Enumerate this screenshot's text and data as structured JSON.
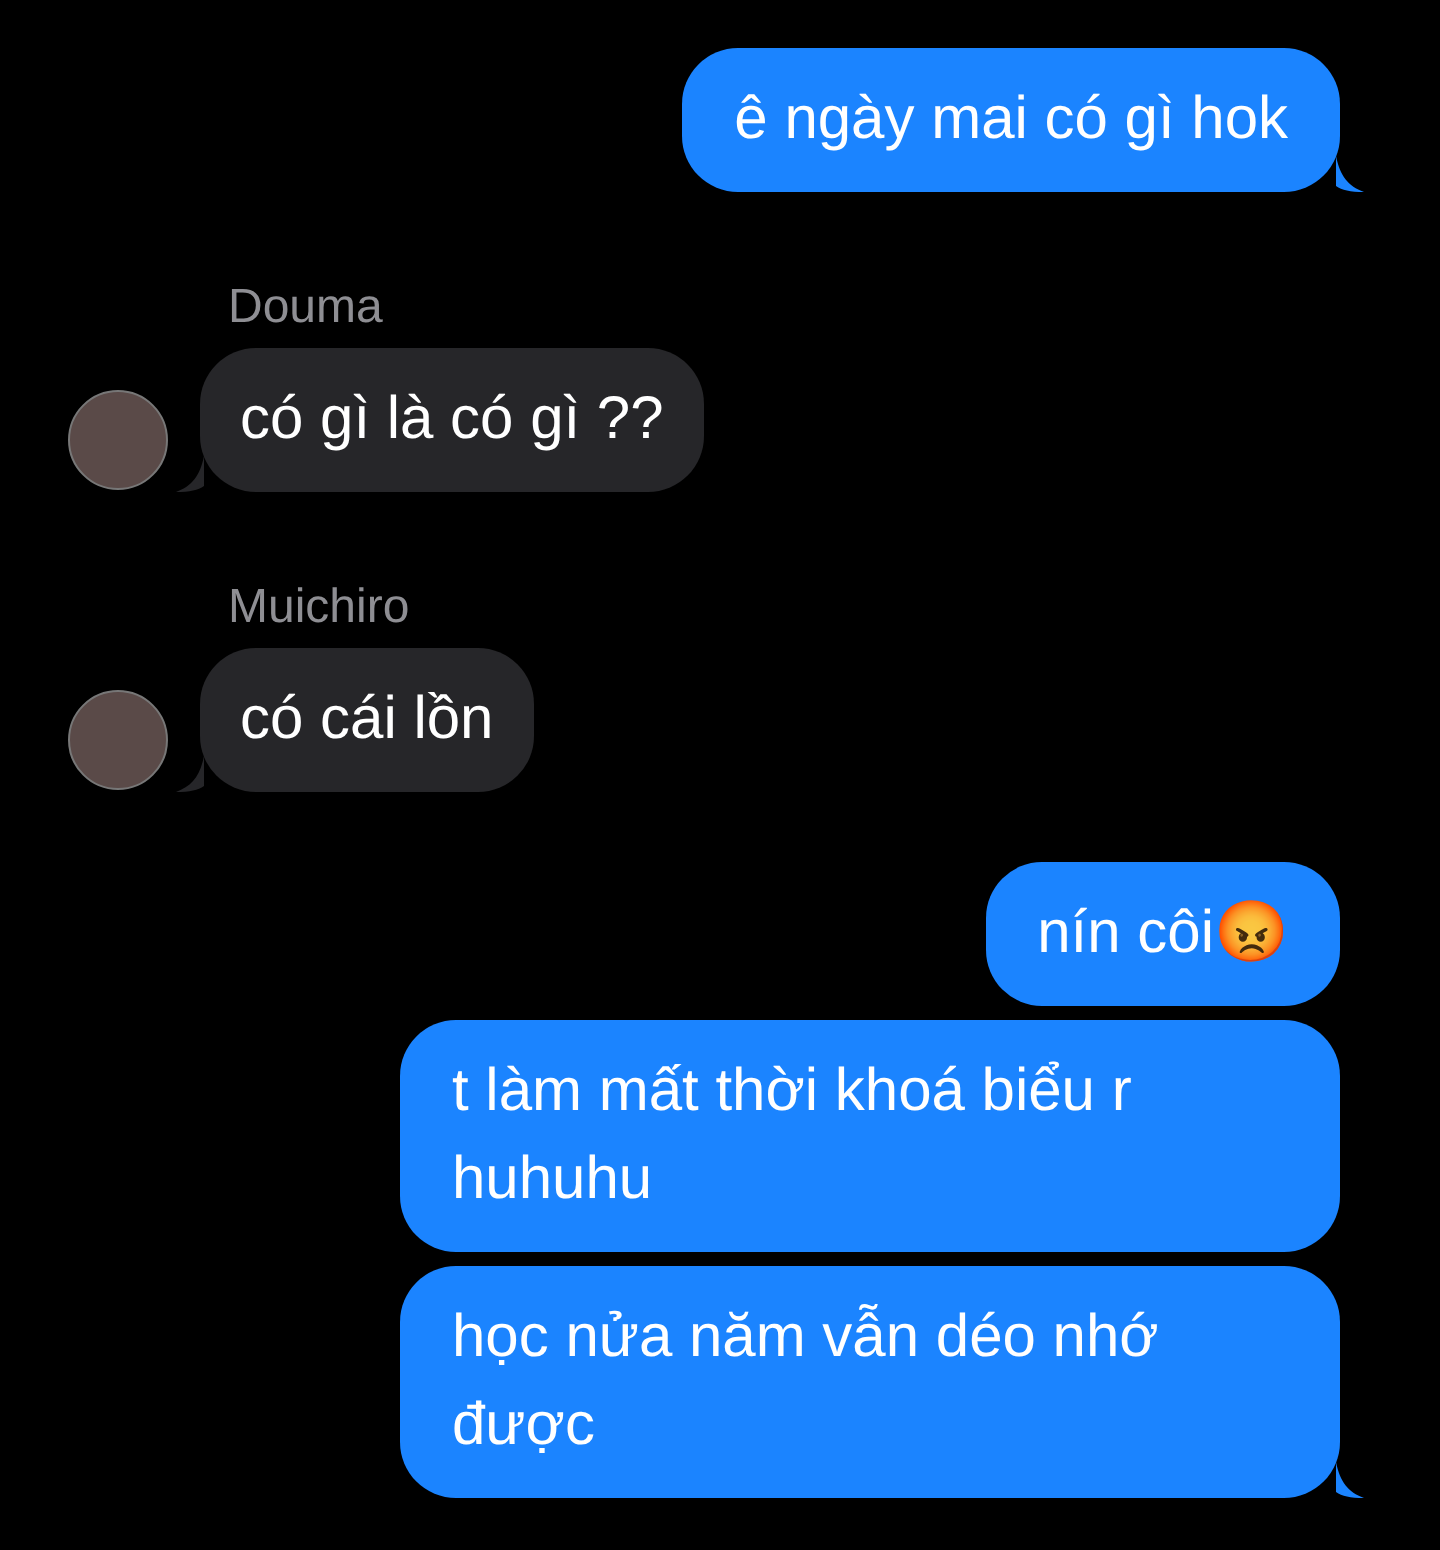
{
  "messages": [
    {
      "kind": "sent",
      "text": "ê ngày mai có gì hok",
      "tail": true
    },
    {
      "kind": "received",
      "sender": "Douma",
      "text": "có gì là có gì ??",
      "tail": true
    },
    {
      "kind": "received",
      "sender": "Muichiro",
      "text": "có cái lồn",
      "tail": true
    },
    {
      "kind": "sent",
      "text": "nín côi😡",
      "tail": false
    },
    {
      "kind": "sent",
      "text": "t làm mất thời khoá biểu r huhuhu",
      "tail": false
    },
    {
      "kind": "sent",
      "text": "học nửa năm vẫn déo nhớ được",
      "tail": true
    }
  ]
}
